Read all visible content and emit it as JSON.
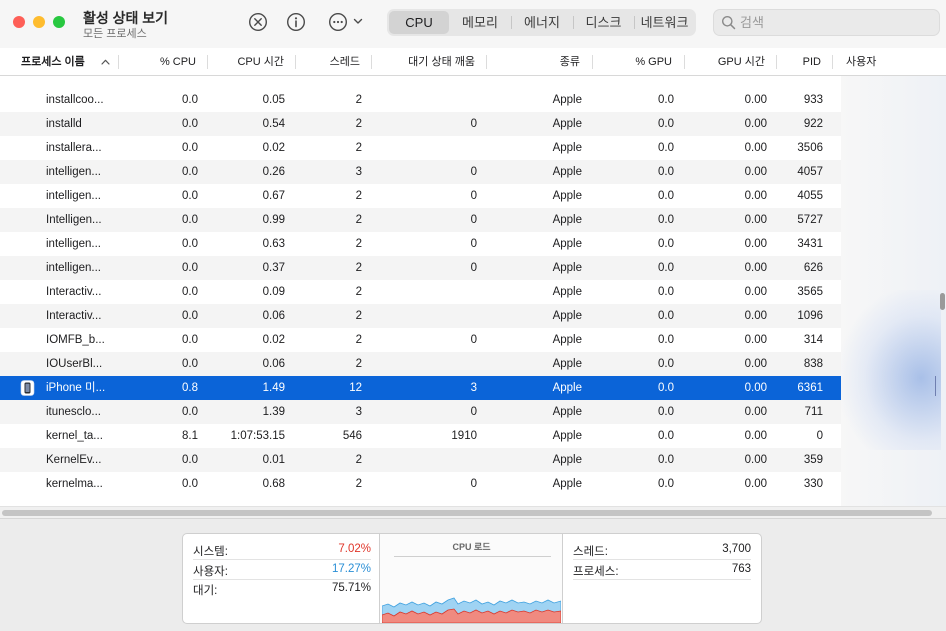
{
  "window": {
    "title": "활성 상태 보기",
    "subtitle": "모든 프로세스"
  },
  "toolbar": {
    "icons": [
      "stop-process-icon",
      "info-icon",
      "more-actions-icon",
      "chevron-down-icon"
    ],
    "tabs": [
      {
        "label": "CPU",
        "active": true
      },
      {
        "label": "메모리",
        "active": false
      },
      {
        "label": "에너지",
        "active": false
      },
      {
        "label": "디스크",
        "active": false
      },
      {
        "label": "네트워크",
        "active": false
      }
    ],
    "search": {
      "placeholder": "검색",
      "value": ""
    }
  },
  "table": {
    "columns": [
      {
        "key": "name",
        "label": "프로세스 이름",
        "sorted": "ascending"
      },
      {
        "key": "cpu",
        "label": "% CPU"
      },
      {
        "key": "cpu_time",
        "label": "CPU 시간"
      },
      {
        "key": "threads",
        "label": "스레드"
      },
      {
        "key": "idle_wakeups",
        "label": "대기 상태 깨움"
      },
      {
        "key": "kind",
        "label": "종류"
      },
      {
        "key": "gpu",
        "label": "% GPU"
      },
      {
        "key": "gpu_time",
        "label": "GPU 시간"
      },
      {
        "key": "pid",
        "label": "PID"
      },
      {
        "key": "user",
        "label": "사용자"
      }
    ],
    "rows": [
      {
        "name": "installcoo...",
        "cpu": "0.0",
        "cpu_time": "0.05",
        "threads": "2",
        "idle_wakeups": "",
        "kind": "Apple",
        "gpu": "0.0",
        "gpu_time": "0.00",
        "pid": "933",
        "user": ""
      },
      {
        "name": "installd",
        "cpu": "0.0",
        "cpu_time": "0.54",
        "threads": "2",
        "idle_wakeups": "0",
        "kind": "Apple",
        "gpu": "0.0",
        "gpu_time": "0.00",
        "pid": "922",
        "user": ""
      },
      {
        "name": "installera...",
        "cpu": "0.0",
        "cpu_time": "0.02",
        "threads": "2",
        "idle_wakeups": "",
        "kind": "Apple",
        "gpu": "0.0",
        "gpu_time": "0.00",
        "pid": "3506",
        "user": ""
      },
      {
        "name": "intelligen...",
        "cpu": "0.0",
        "cpu_time": "0.26",
        "threads": "3",
        "idle_wakeups": "0",
        "kind": "Apple",
        "gpu": "0.0",
        "gpu_time": "0.00",
        "pid": "4057",
        "user": ""
      },
      {
        "name": "intelligen...",
        "cpu": "0.0",
        "cpu_time": "0.67",
        "threads": "2",
        "idle_wakeups": "0",
        "kind": "Apple",
        "gpu": "0.0",
        "gpu_time": "0.00",
        "pid": "4055",
        "user": ""
      },
      {
        "name": "Intelligen...",
        "cpu": "0.0",
        "cpu_time": "0.99",
        "threads": "2",
        "idle_wakeups": "0",
        "kind": "Apple",
        "gpu": "0.0",
        "gpu_time": "0.00",
        "pid": "5727",
        "user": ""
      },
      {
        "name": "intelligen...",
        "cpu": "0.0",
        "cpu_time": "0.63",
        "threads": "2",
        "idle_wakeups": "0",
        "kind": "Apple",
        "gpu": "0.0",
        "gpu_time": "0.00",
        "pid": "3431",
        "user": ""
      },
      {
        "name": "intelligen...",
        "cpu": "0.0",
        "cpu_time": "0.37",
        "threads": "2",
        "idle_wakeups": "0",
        "kind": "Apple",
        "gpu": "0.0",
        "gpu_time": "0.00",
        "pid": "626",
        "user": ""
      },
      {
        "name": "Interactiv...",
        "cpu": "0.0",
        "cpu_time": "0.09",
        "threads": "2",
        "idle_wakeups": "",
        "kind": "Apple",
        "gpu": "0.0",
        "gpu_time": "0.00",
        "pid": "3565",
        "user": ""
      },
      {
        "name": "Interactiv...",
        "cpu": "0.0",
        "cpu_time": "0.06",
        "threads": "2",
        "idle_wakeups": "",
        "kind": "Apple",
        "gpu": "0.0",
        "gpu_time": "0.00",
        "pid": "1096",
        "user": ""
      },
      {
        "name": "IOMFB_b...",
        "cpu": "0.0",
        "cpu_time": "0.02",
        "threads": "2",
        "idle_wakeups": "0",
        "kind": "Apple",
        "gpu": "0.0",
        "gpu_time": "0.00",
        "pid": "314",
        "user": ""
      },
      {
        "name": "IOUserBl...",
        "cpu": "0.0",
        "cpu_time": "0.06",
        "threads": "2",
        "idle_wakeups": "",
        "kind": "Apple",
        "gpu": "0.0",
        "gpu_time": "0.00",
        "pid": "838",
        "user": ""
      },
      {
        "name": "iPhone 미...",
        "cpu": "0.8",
        "cpu_time": "1.49",
        "threads": "12",
        "idle_wakeups": "3",
        "kind": "Apple",
        "gpu": "0.0",
        "gpu_time": "0.00",
        "pid": "6361",
        "user": "",
        "selected": true,
        "icon": "iphone-mirroring-app-icon"
      },
      {
        "name": "itunesclo...",
        "cpu": "0.0",
        "cpu_time": "1.39",
        "threads": "3",
        "idle_wakeups": "0",
        "kind": "Apple",
        "gpu": "0.0",
        "gpu_time": "0.00",
        "pid": "711",
        "user": ""
      },
      {
        "name": "kernel_ta...",
        "cpu": "8.1",
        "cpu_time": "1:07:53.15",
        "threads": "546",
        "idle_wakeups": "1910",
        "kind": "Apple",
        "gpu": "0.0",
        "gpu_time": "0.00",
        "pid": "0",
        "user": ""
      },
      {
        "name": "KernelEv...",
        "cpu": "0.0",
        "cpu_time": "0.01",
        "threads": "2",
        "idle_wakeups": "",
        "kind": "Apple",
        "gpu": "0.0",
        "gpu_time": "0.00",
        "pid": "359",
        "user": ""
      },
      {
        "name": "kernelma...",
        "cpu": "0.0",
        "cpu_time": "0.68",
        "threads": "2",
        "idle_wakeups": "0",
        "kind": "Apple",
        "gpu": "0.0",
        "gpu_time": "0.00",
        "pid": "330",
        "user": ""
      }
    ]
  },
  "summary": {
    "system_label": "시스템:",
    "system_value": "7.02%",
    "user_label": "사용자:",
    "user_value": "17.27%",
    "idle_label": "대기:",
    "idle_value": "75.71%",
    "cpu_load_title": "CPU 로드",
    "threads_label": "스레드:",
    "threads_value": "3,700",
    "processes_label": "프로세스:",
    "processes_value": "763"
  },
  "colors": {
    "accent": "#0b64d8",
    "system": "#e0362a",
    "user": "#2a8fd6",
    "graph_system_fill": "#f08a80",
    "graph_user_fill": "#9fd3f3"
  }
}
